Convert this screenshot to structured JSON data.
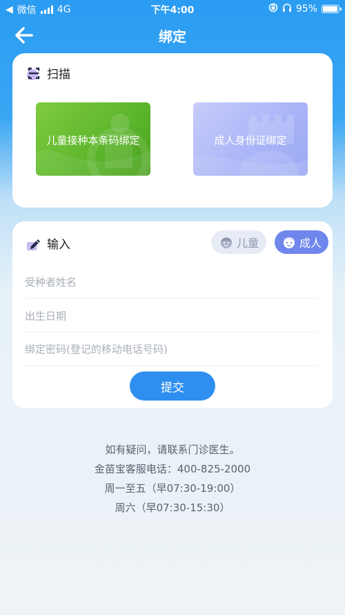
{
  "status_bar": {
    "back_app": "微信",
    "network": "4G",
    "time": "下午4:00",
    "battery": "95%"
  },
  "nav": {
    "title": "绑定"
  },
  "scan": {
    "title": "扫描",
    "child_tile": "儿童接种本条码绑定",
    "adult_tile": "成人身份证绑定"
  },
  "input": {
    "title": "输入",
    "toggle_child": "儿童",
    "toggle_adult": "成人",
    "selected": "成人",
    "name_placeholder": "受种者姓名",
    "birth_placeholder": "出生日期",
    "password_placeholder": "绑定密码(登记的移动电话号码)",
    "submit": "提交"
  },
  "footer": {
    "line1": "如有疑问，请联系门诊医生。",
    "line2": "金苗宝客服电话：400-825-2000",
    "line3": "周一至五（早07:30-19:00）",
    "line4": "周六（早07:30-15:30）"
  },
  "colors": {
    "header_blue": "#2a9cf2",
    "child_tile_green": "#5cb52c",
    "adult_tile_lavender": "#a9b4f7",
    "adult_toggle_active": "#6f86ec",
    "submit_blue": "#2f8ff0"
  }
}
